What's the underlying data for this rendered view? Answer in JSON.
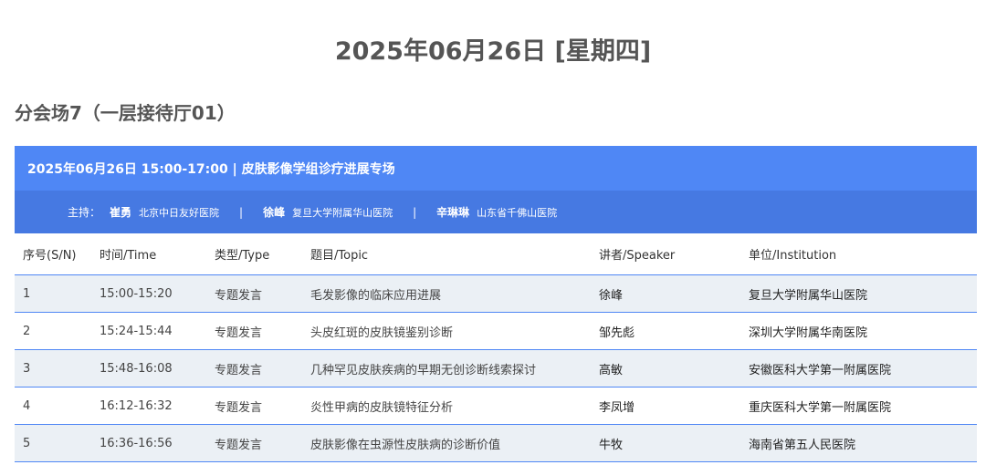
{
  "date_heading": "2025年06月26日 [星期四]",
  "venue_heading": "分会场7（一层接待厅01）",
  "session": {
    "title": "2025年06月26日 15:00-17:00 | 皮肤影像学组诊疗进展专场",
    "host_label": "主持：",
    "hosts": [
      {
        "name": "崔勇",
        "institution": "北京中日友好医院"
      },
      {
        "name": "徐峰",
        "institution": "复旦大学附属华山医院"
      },
      {
        "name": "辛琳琳",
        "institution": "山东省千佛山医院"
      }
    ],
    "separator": "|"
  },
  "table": {
    "headers": [
      "序号(S/N)",
      "时间/Time",
      "类型/Type",
      "题目/Topic",
      "讲者/Speaker",
      "单位/Institution"
    ],
    "rows": [
      [
        "1",
        "15:00-15:20",
        "专题发言",
        "毛发影像的临床应用进展",
        "徐峰",
        "复旦大学附属华山医院"
      ],
      [
        "2",
        "15:24-15:44",
        "专题发言",
        "头皮红斑的皮肤镜鉴别诊断",
        "邹先彪",
        "深圳大学附属华南医院"
      ],
      [
        "3",
        "15:48-16:08",
        "专题发言",
        "几种罕见皮肤疾病的早期无创诊断线索探讨",
        "高敏",
        "安徽医科大学第一附属医院"
      ],
      [
        "4",
        "16:12-16:32",
        "专题发言",
        "炎性甲病的皮肤镜特征分析",
        "李凤增",
        "重庆医科大学第一附属医院"
      ],
      [
        "5",
        "16:36-16:56",
        "专题发言",
        "皮肤影像在虫源性皮肤病的诊断价值",
        "牛牧",
        "海南省第五人民医院"
      ]
    ]
  },
  "colors": {
    "session_header": "#4f87f5",
    "hosts_bar": "#4679e2",
    "row_shade": "#ebf0f5",
    "row_border": "#4f87f5"
  }
}
